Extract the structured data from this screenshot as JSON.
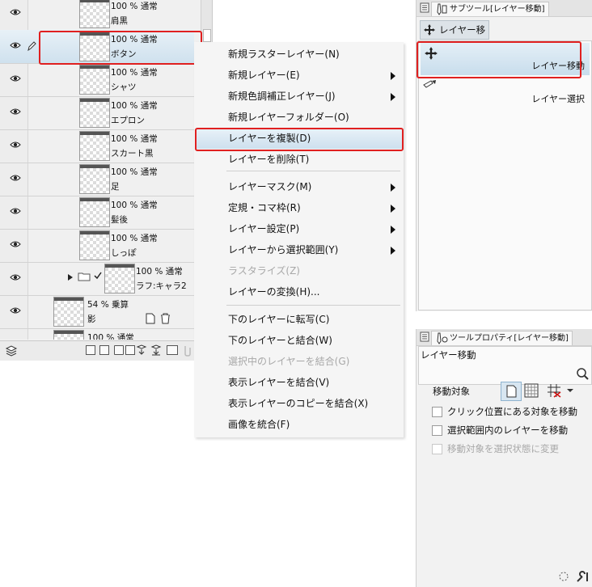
{
  "layers": [
    {
      "opacity": "100 % 通常",
      "name": "肩黒"
    },
    {
      "opacity": "100 % 通常",
      "name": "ボタン",
      "selected": true
    },
    {
      "opacity": "100 % 通常",
      "name": "シャツ"
    },
    {
      "opacity": "100 % 通常",
      "name": "エプロン"
    },
    {
      "opacity": "100 % 通常",
      "name": "スカート黒"
    },
    {
      "opacity": "100 % 通常",
      "name": "足"
    },
    {
      "opacity": "100 % 通常",
      "name": "髪後"
    },
    {
      "opacity": "100 % 通常",
      "name": "しっぽ"
    },
    {
      "opacity": "100 % 通常",
      "name": "ラフ:キャラ2"
    },
    {
      "opacity": "54 % 乗算",
      "name": "影"
    },
    {
      "opacity": "100 % 通常",
      "name": ""
    }
  ],
  "context_menu": {
    "items": [
      {
        "label": "新規ラスターレイヤー(N)",
        "submenu": false,
        "disabled": false
      },
      {
        "label": "新規レイヤー(E)",
        "submenu": true,
        "disabled": false
      },
      {
        "label": "新規色調補正レイヤー(J)",
        "submenu": true,
        "disabled": false
      },
      {
        "label": "新規レイヤーフォルダー(O)",
        "submenu": false,
        "disabled": false
      },
      {
        "label": "レイヤーを複製(D)",
        "submenu": false,
        "disabled": false,
        "highlighted": true
      },
      {
        "label": "レイヤーを削除(T)",
        "submenu": false,
        "disabled": false
      },
      {
        "label": "レイヤーマスク(M)",
        "submenu": true,
        "disabled": false
      },
      {
        "label": "定規・コマ枠(R)",
        "submenu": true,
        "disabled": false
      },
      {
        "label": "レイヤー設定(P)",
        "submenu": true,
        "disabled": false
      },
      {
        "label": "レイヤーから選択範囲(Y)",
        "submenu": true,
        "disabled": false
      },
      {
        "label": "ラスタライズ(Z)",
        "submenu": false,
        "disabled": true
      },
      {
        "label": "レイヤーの変換(H)...",
        "submenu": false,
        "disabled": false
      },
      {
        "label": "下のレイヤーに転写(C)",
        "submenu": false,
        "disabled": false
      },
      {
        "label": "下のレイヤーと結合(W)",
        "submenu": false,
        "disabled": false
      },
      {
        "label": "選択中のレイヤーを結合(G)",
        "submenu": false,
        "disabled": true
      },
      {
        "label": "表示レイヤーを結合(V)",
        "submenu": false,
        "disabled": false
      },
      {
        "label": "表示レイヤーのコピーを結合(X)",
        "submenu": false,
        "disabled": false
      },
      {
        "label": "画像を統合(F)",
        "submenu": false,
        "disabled": false
      }
    ]
  },
  "subtool": {
    "tab_title": "サブツール[レイヤー移動]",
    "group_label": "レイヤー移",
    "tools": [
      {
        "name": "レイヤー移動",
        "selected": true
      },
      {
        "name": "レイヤー選択",
        "selected": false
      }
    ]
  },
  "tool_property": {
    "tab_title": "ツールプロパティ[レイヤー移動]",
    "tool_name": "レイヤー移動",
    "move_target_label": "移動対象",
    "options": [
      {
        "label": "クリック位置にある対象を移動",
        "checked": false,
        "disabled": false
      },
      {
        "label": "選択範囲内のレイヤーを移動",
        "checked": false,
        "disabled": false
      },
      {
        "label": "移動対象を選択状態に変更",
        "checked": false,
        "disabled": true
      }
    ]
  },
  "colors": {
    "highlight_red": "#e02020",
    "selection_blue": "#cde0ee"
  }
}
